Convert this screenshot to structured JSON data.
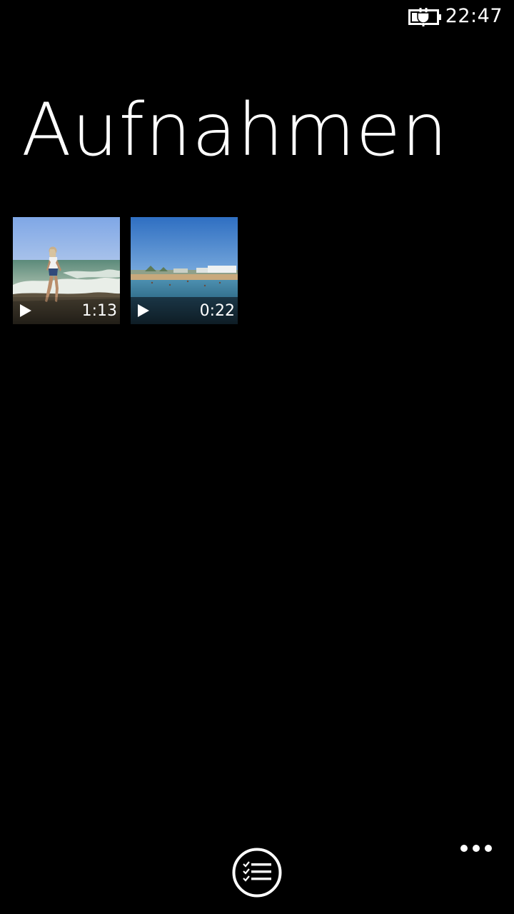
{
  "status_bar": {
    "time": "22:47",
    "battery_icon": "battery-charging-icon"
  },
  "page": {
    "title": "Aufnahmen"
  },
  "videos": [
    {
      "duration": "1:13",
      "thumbnail": "beach-waves-person"
    },
    {
      "duration": "0:22",
      "thumbnail": "beach-resort-sea"
    }
  ],
  "app_bar": {
    "select_icon": "select-list-icon",
    "more_icon": "more-dots-icon"
  }
}
